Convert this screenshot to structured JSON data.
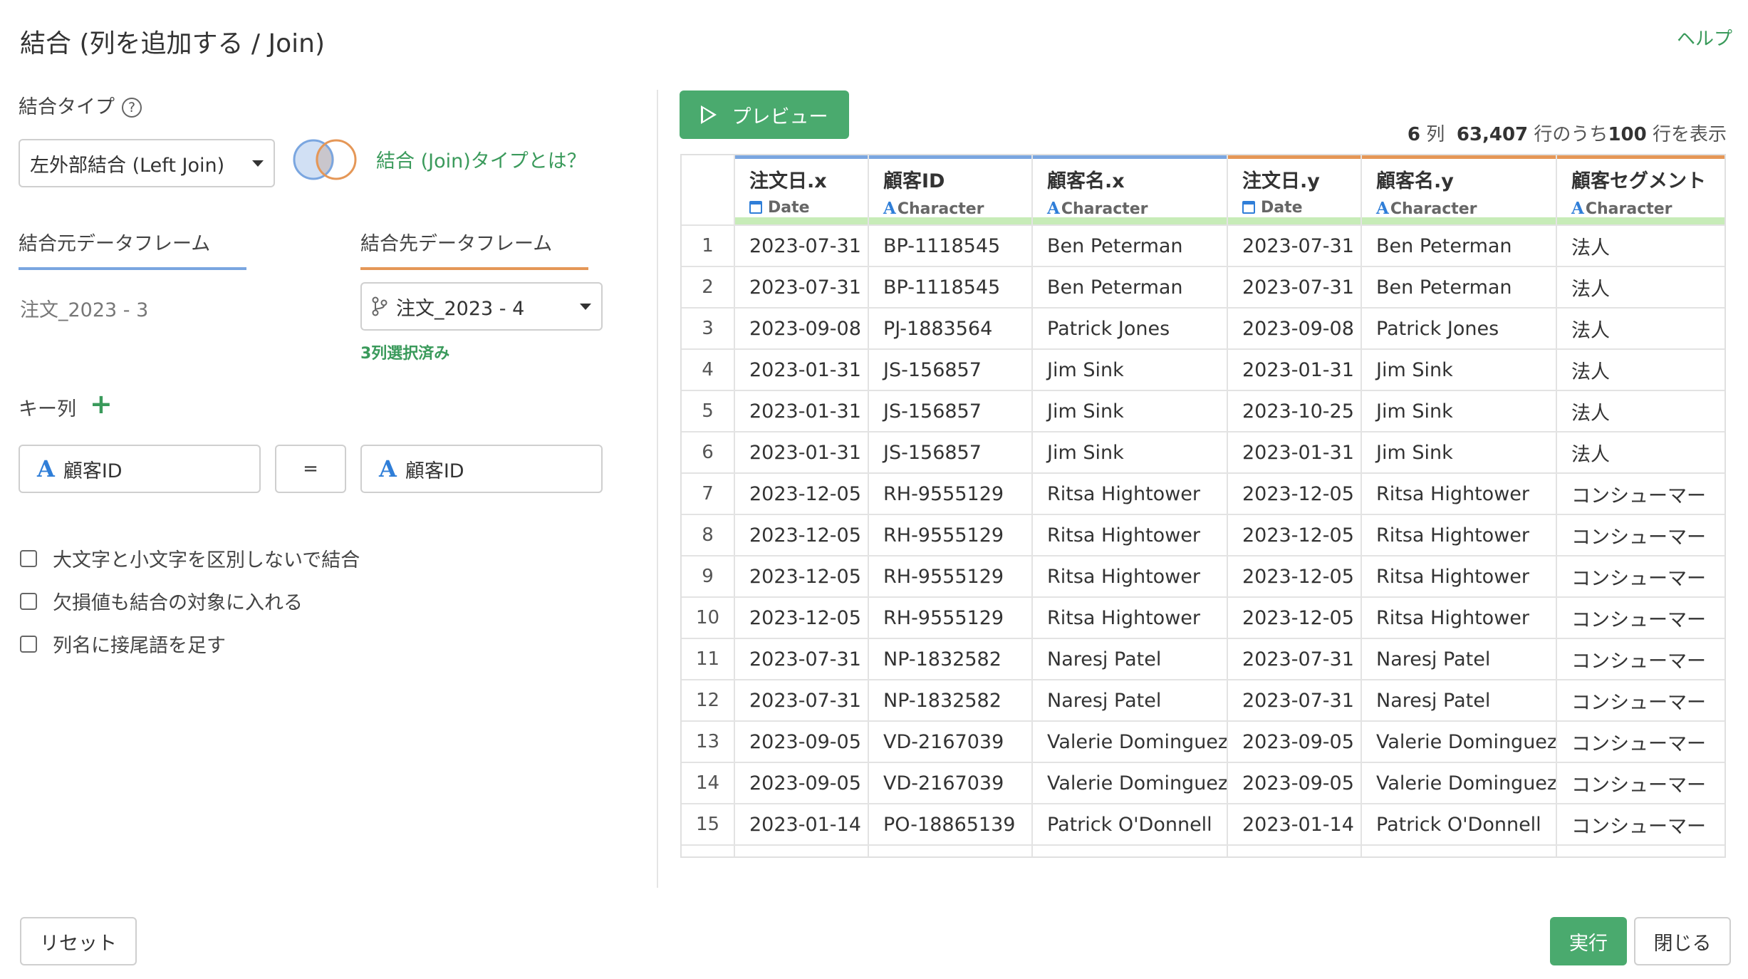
{
  "dialog": {
    "title": "結合 (列を追加する / Join)",
    "help_link": "ヘルプ"
  },
  "join_type": {
    "label": "結合タイプ",
    "help_icon": "?",
    "selected": "左外部結合 (Left Join)",
    "venn_icon": "venn-diagram-icon",
    "about_link": "結合 (Join)タイプとは？"
  },
  "dataframes": {
    "source_label": "結合元データフレーム",
    "target_label": "結合先データフレーム",
    "source_value": "注文_2023 - 3",
    "target_value": "注文_2023 - 4",
    "selected_note": "3列選択済み",
    "source_color": "#7aa6e0",
    "target_color": "#e59757"
  },
  "keys": {
    "label": "キー列",
    "left_key": "顧客ID",
    "operator": "=",
    "right_key": "顧客ID"
  },
  "options": [
    "大文字と小文字を区別しないで結合",
    "欠損値も結合の対象に入れる",
    "列名に接尾語を足す"
  ],
  "preview": {
    "button": "プレビュー",
    "cols_count": "6",
    "cols_unit": "列",
    "total_rows": "63,407",
    "rows_of": "行のうち",
    "shown_rows": "100",
    "rows_suffix": "行を表示"
  },
  "table": {
    "columns": [
      {
        "name": "注文日.x",
        "type": "Date",
        "side": "blue"
      },
      {
        "name": "顧客ID",
        "type": "Character",
        "side": "blue"
      },
      {
        "name": "顧客名.x",
        "type": "Character",
        "side": "blue"
      },
      {
        "name": "注文日.y",
        "type": "Date",
        "side": "orange"
      },
      {
        "name": "顧客名.y",
        "type": "Character",
        "side": "orange"
      },
      {
        "name": "顧客セグメント",
        "type": "Character",
        "side": "orange"
      }
    ],
    "rows": [
      [
        "1",
        "2023-07-31",
        "BP-1118545",
        "Ben Peterman",
        "2023-07-31",
        "Ben Peterman",
        "法人"
      ],
      [
        "2",
        "2023-07-31",
        "BP-1118545",
        "Ben Peterman",
        "2023-07-31",
        "Ben Peterman",
        "法人"
      ],
      [
        "3",
        "2023-09-08",
        "PJ-1883564",
        "Patrick Jones",
        "2023-09-08",
        "Patrick Jones",
        "法人"
      ],
      [
        "4",
        "2023-01-31",
        "JS-156857",
        "Jim Sink",
        "2023-01-31",
        "Jim Sink",
        "法人"
      ],
      [
        "5",
        "2023-01-31",
        "JS-156857",
        "Jim Sink",
        "2023-10-25",
        "Jim Sink",
        "法人"
      ],
      [
        "6",
        "2023-01-31",
        "JS-156857",
        "Jim Sink",
        "2023-01-31",
        "Jim Sink",
        "法人"
      ],
      [
        "7",
        "2023-12-05",
        "RH-9555129",
        "Ritsa Hightower",
        "2023-12-05",
        "Ritsa Hightower",
        "コンシューマー"
      ],
      [
        "8",
        "2023-12-05",
        "RH-9555129",
        "Ritsa Hightower",
        "2023-12-05",
        "Ritsa Hightower",
        "コンシューマー"
      ],
      [
        "9",
        "2023-12-05",
        "RH-9555129",
        "Ritsa Hightower",
        "2023-12-05",
        "Ritsa Hightower",
        "コンシューマー"
      ],
      [
        "10",
        "2023-12-05",
        "RH-9555129",
        "Ritsa Hightower",
        "2023-12-05",
        "Ritsa Hightower",
        "コンシューマー"
      ],
      [
        "11",
        "2023-07-31",
        "NP-1832582",
        "Naresj Patel",
        "2023-07-31",
        "Naresj Patel",
        "コンシューマー"
      ],
      [
        "12",
        "2023-07-31",
        "NP-1832582",
        "Naresj Patel",
        "2023-07-31",
        "Naresj Patel",
        "コンシューマー"
      ],
      [
        "13",
        "2023-09-05",
        "VD-2167039",
        "Valerie Dominguez",
        "2023-09-05",
        "Valerie Dominguez",
        "コンシューマー"
      ],
      [
        "14",
        "2023-09-05",
        "VD-2167039",
        "Valerie Dominguez",
        "2023-09-05",
        "Valerie Dominguez",
        "コンシューマー"
      ],
      [
        "15",
        "2023-01-14",
        "PO-18865139",
        "Patrick O'Donnell",
        "2023-01-14",
        "Patrick O'Donnell",
        "コンシューマー"
      ]
    ]
  },
  "footer": {
    "reset": "リセット",
    "run": "実行",
    "close": "閉じる"
  }
}
